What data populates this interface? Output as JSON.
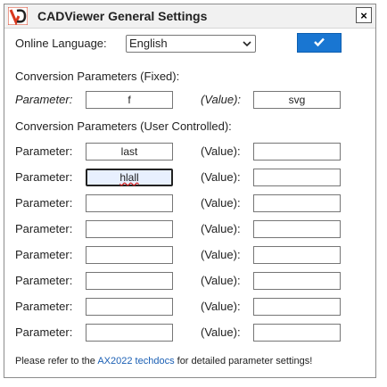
{
  "window": {
    "title": "CADViewer General Settings",
    "close_label": "×"
  },
  "language": {
    "label": "Online Language:",
    "selected": "English"
  },
  "fixed_section": {
    "heading": "Conversion Parameters (Fixed):",
    "param_label": "Parameter:",
    "value_label": "(Value):",
    "param": "f",
    "value": "svg"
  },
  "user_section": {
    "heading": "Conversion Parameters (User Controlled):",
    "param_label": "Parameter:",
    "value_label": "(Value):",
    "rows": [
      {
        "param": "last",
        "value": ""
      },
      {
        "param": "hlall",
        "value": ""
      },
      {
        "param": "",
        "value": ""
      },
      {
        "param": "",
        "value": ""
      },
      {
        "param": "",
        "value": ""
      },
      {
        "param": "",
        "value": ""
      },
      {
        "param": "",
        "value": ""
      },
      {
        "param": "",
        "value": ""
      }
    ]
  },
  "footer": {
    "prefix": "Please refer to the ",
    "link": "AX2022 techdocs",
    "suffix": " for detailed parameter settings!"
  },
  "colors": {
    "accent": "#1976d2",
    "link": "#1a5fb4",
    "logo_red": "#d9381e"
  },
  "icons": {
    "logo": "cadviewer-logo-icon",
    "close": "close-icon",
    "confirm": "checkmark-icon",
    "dropdown": "chevron-down-icon"
  }
}
